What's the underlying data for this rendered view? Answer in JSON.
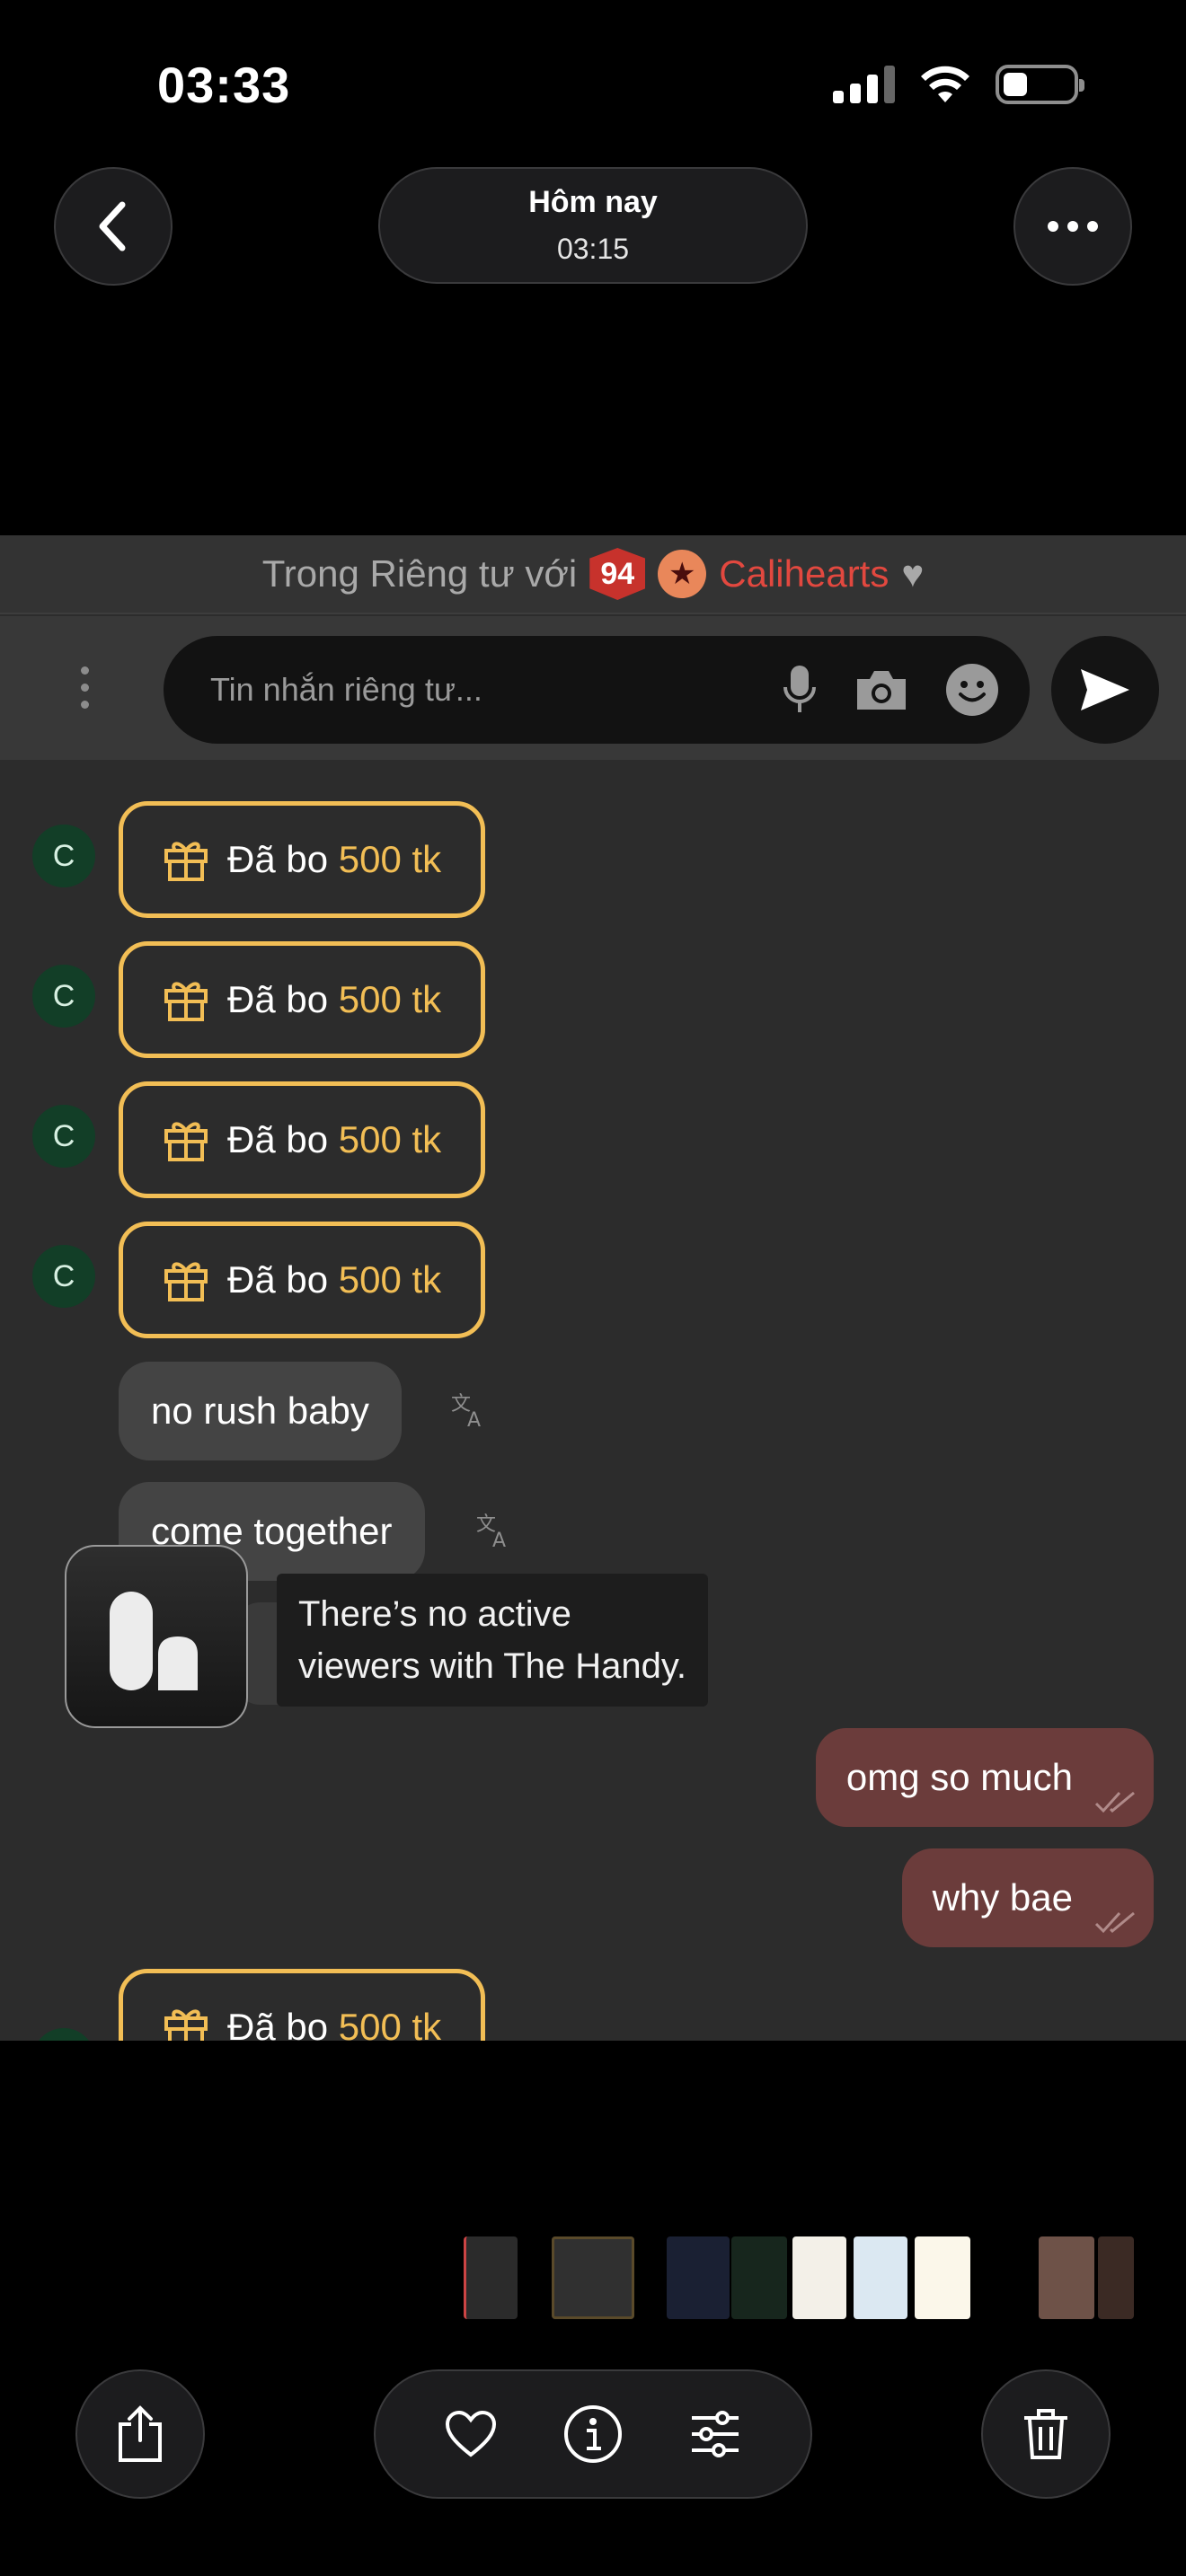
{
  "status_bar": {
    "time": "03:33",
    "signal_icon": "signal-icon",
    "wifi_icon": "wifi-icon",
    "battery_icon": "battery-icon"
  },
  "viewer": {
    "back_icon": "chevron-left-icon",
    "date_title": "Hôm nay",
    "date_time": "03:15",
    "more_icon": "ellipsis-icon"
  },
  "chat": {
    "private_prefix": "Trong Riêng tư với",
    "level": "94",
    "username": "Calihearts",
    "input_placeholder": "Tin nhắn riêng tư...",
    "icons": [
      "more-vertical-icon",
      "mic-icon",
      "camera-icon",
      "emoji-icon",
      "send-icon"
    ],
    "gift_text": "Đã bo",
    "gift_amount": "500 tk",
    "avatar_letter": "C",
    "incoming": [
      "no rush baby",
      "come together"
    ],
    "outgoing": [
      "omg so much",
      "why bae"
    ],
    "handy_tooltip_line1": "There’s no active",
    "handy_tooltip_line2": "viewers with The Handy.",
    "colors": {
      "gift_border": "#f2be55",
      "outgoing_bubble": "#6b3c3b",
      "username": "#e2483f",
      "level_badge": "#c7322c"
    }
  },
  "toolbar": {
    "icons": [
      "share-icon",
      "heart-icon",
      "info-icon",
      "adjust-icon",
      "trash-icon"
    ]
  }
}
